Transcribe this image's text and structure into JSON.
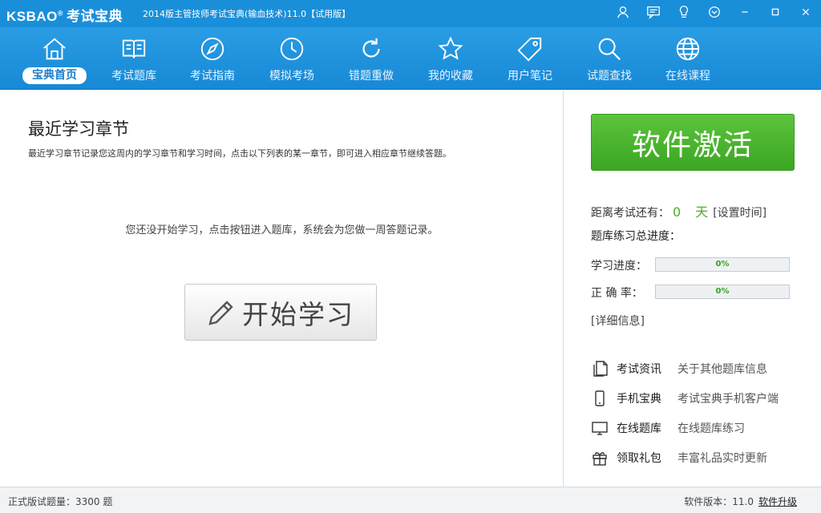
{
  "titlebar": {
    "logo_text": "KSBAO",
    "logo_mark": "®",
    "logo_cn": "考试宝典",
    "app_title": "2014版主管技师考试宝典(输血技术)11.0【试用版】",
    "controls": [
      "user-icon",
      "message-icon",
      "bulb-icon",
      "chevron-down-icon",
      "minimize-icon",
      "maximize-icon",
      "close-icon"
    ]
  },
  "nav": {
    "items": [
      {
        "label": "宝典首页",
        "icon": "home-icon"
      },
      {
        "label": "考试题库",
        "icon": "book-icon"
      },
      {
        "label": "考试指南",
        "icon": "compass-icon"
      },
      {
        "label": "模拟考场",
        "icon": "clock-icon"
      },
      {
        "label": "错题重做",
        "icon": "refresh-icon"
      },
      {
        "label": "我的收藏",
        "icon": "star-icon"
      },
      {
        "label": "用户笔记",
        "icon": "tag-icon"
      },
      {
        "label": "试题查找",
        "icon": "search-icon"
      },
      {
        "label": "在线课程",
        "icon": "globe-icon"
      }
    ],
    "active_index": 0
  },
  "main": {
    "section_title": "最近学习章节",
    "section_desc": "最近学习章节记录您这周内的学习章节和学习时间，点击以下列表的某一章节，即可进入相应章节继续答题。",
    "empty_message": "您还没开始学习，点击按钮进入题库，系统会为您做一周答题记录。",
    "start_button": "开始学习"
  },
  "sidebar": {
    "activate_button": "软件激活",
    "countdown_label": "距离考试还有：",
    "countdown_days": "0",
    "countdown_unit": "天",
    "set_time_link": "[设置时间]",
    "progress_title": "题库练习总进度：",
    "study_label": "学习进度：",
    "study_value": "0%",
    "accuracy_label": "正 确 率：",
    "accuracy_value": "0%",
    "detail_link": "[详细信息]",
    "links": [
      {
        "main": "考试资讯",
        "sub": "关于其他题库信息",
        "icon": "document-icon"
      },
      {
        "main": "手机宝典",
        "sub": "考试宝典手机客户端",
        "icon": "phone-icon"
      },
      {
        "main": "在线题库",
        "sub": "在线题库练习",
        "icon": "monitor-icon"
      },
      {
        "main": "领取礼包",
        "sub": "丰富礼品实时更新",
        "icon": "gift-icon"
      }
    ]
  },
  "status": {
    "question_count": "正式版试题量：3300 题",
    "version": "软件版本：11.0",
    "upgrade": "软件升级"
  }
}
